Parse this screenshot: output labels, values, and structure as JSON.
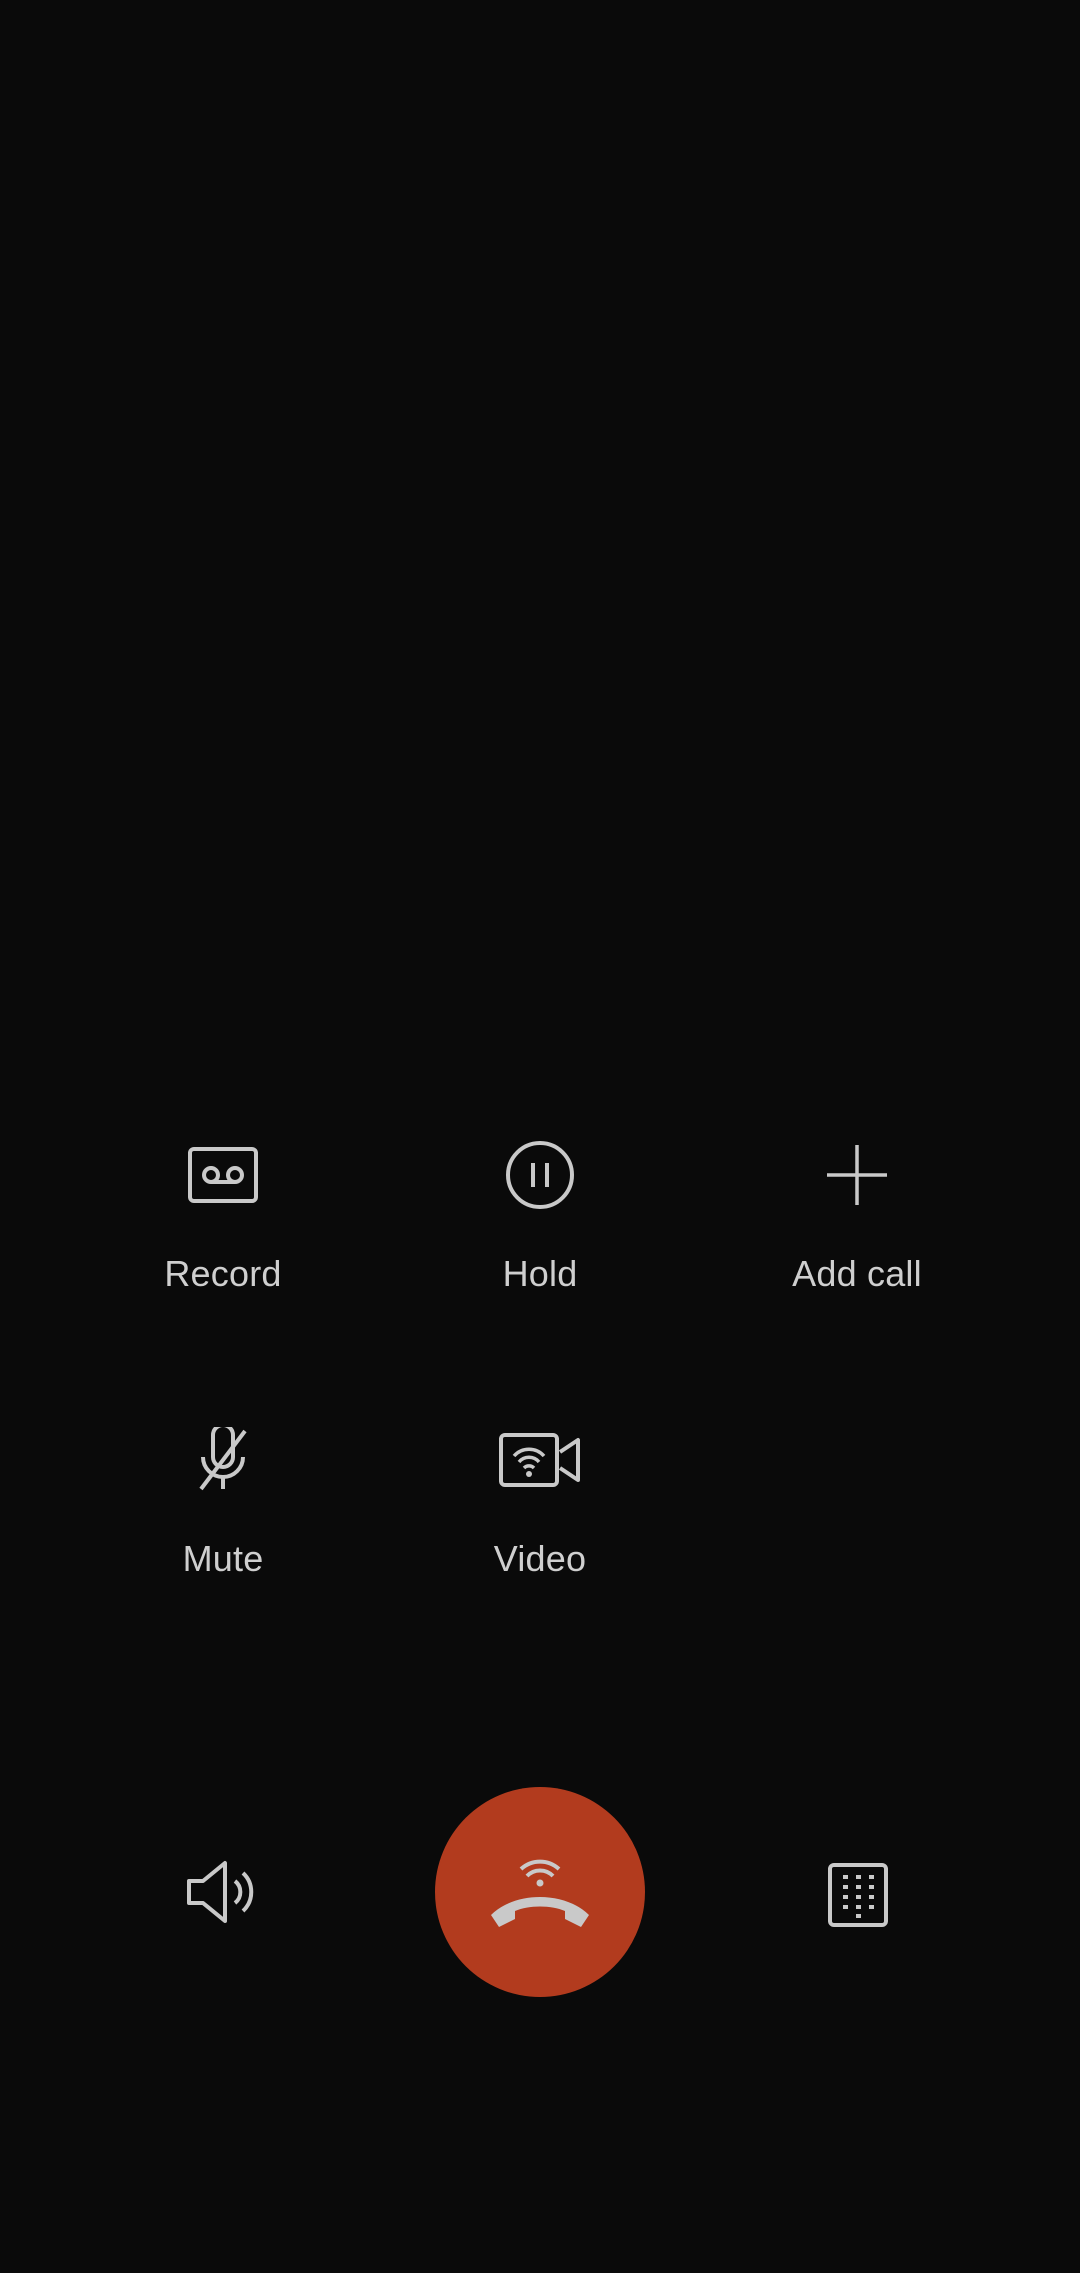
{
  "colors": {
    "background": "#0a0a0a",
    "icon": "#c9c9c9",
    "label": "#cfcfcf",
    "end_call": "#b23b1e"
  },
  "actions": {
    "record": {
      "label": "Record",
      "icon": "voicemail-record-icon"
    },
    "hold": {
      "label": "Hold",
      "icon": "pause-circle-icon"
    },
    "add_call": {
      "label": "Add call",
      "icon": "plus-icon"
    },
    "mute": {
      "label": "Mute",
      "icon": "microphone-off-icon"
    },
    "video": {
      "label": "Video",
      "icon": "wifi-video-camera-icon"
    }
  },
  "bottom_bar": {
    "speaker": {
      "icon": "speaker-icon"
    },
    "end_call": {
      "icon": "wifi-hang-up-icon"
    },
    "keypad": {
      "icon": "dialpad-icon"
    }
  }
}
